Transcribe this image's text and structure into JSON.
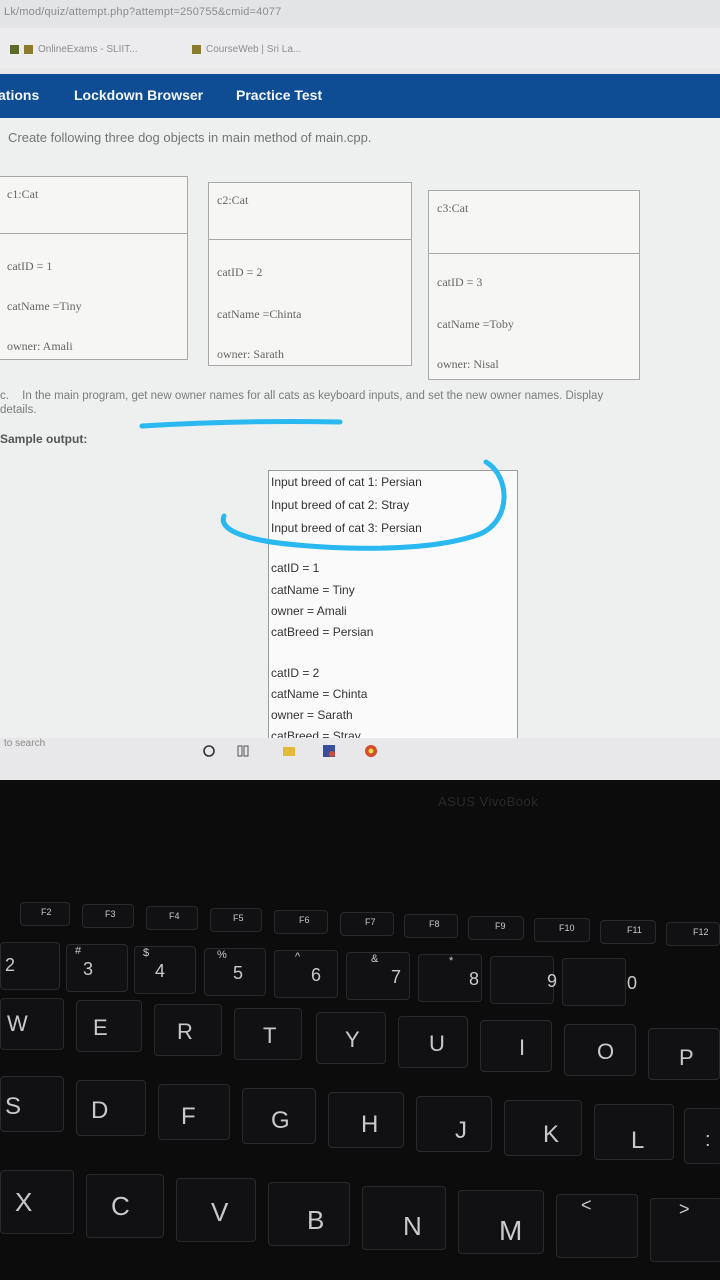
{
  "browser": {
    "url": "Lk/mod/quiz/attempt.php?attempt=250755&cmid=4077",
    "bookmarks": [
      "OnlineExams - SLIIT...",
      "CourseWeb | Sri La..."
    ]
  },
  "nav": {
    "items": [
      "ations",
      "Lockdown Browser",
      "Practice Test"
    ]
  },
  "question": {
    "instruction": "Create following three dog objects in main method of main.cpp.",
    "cats": [
      {
        "header": "c1:Cat",
        "id": "catID = 1",
        "name": "catName =Tiny",
        "owner": "owner: Amali"
      },
      {
        "header": "c2:Cat",
        "id": "catID = 2",
        "name": "catName =Chinta",
        "owner": "owner: Sarath"
      },
      {
        "header": "c3:Cat",
        "id": "catID = 3",
        "name": "catName =Toby",
        "owner": "owner: Nisal"
      }
    ],
    "task_prefix": "c.",
    "task": "In the main program, get new owner names for all cats as keyboard inputs, and set the new owner names. Display",
    "details": "details.",
    "sample_label": "Sample output:"
  },
  "sample_output": [
    "Input breed of cat 1: Persian",
    "Input breed of cat 2: Stray",
    "Input breed of cat 3: Persian",
    "",
    "catID = 1",
    "catName = Tiny",
    "owner = Amali",
    "catBreed = Persian",
    "",
    "catID = 2",
    "catName = Chinta",
    "owner = Sarath",
    "catBreed = Stray"
  ],
  "taskbar": {
    "search": "to search"
  },
  "laptop": {
    "brand": "ASUS VivoBook"
  },
  "keyboard": {
    "fn_row": [
      "F2",
      "F3",
      "F4",
      "F5",
      "F6",
      "F7",
      "F8",
      "F9",
      "F10",
      "F11",
      "F12"
    ],
    "num_row": [
      "2",
      "3",
      "4",
      "5",
      "6",
      "7",
      "8",
      "9",
      "0"
    ],
    "num_shift": [
      "",
      "#",
      "$",
      "%",
      "^",
      "&",
      "*",
      "",
      ""
    ],
    "row_q": [
      "W",
      "E",
      "R",
      "T",
      "Y",
      "U",
      "I",
      "O",
      "P"
    ],
    "row_a": [
      "S",
      "D",
      "F",
      "G",
      "H",
      "J",
      "K",
      "L",
      ":"
    ],
    "row_z": [
      "X",
      "C",
      "V",
      "B",
      "N",
      "M",
      "<",
      ">"
    ]
  },
  "colors": {
    "nav": "#0e4c94",
    "annotation": "#29b8ef"
  }
}
